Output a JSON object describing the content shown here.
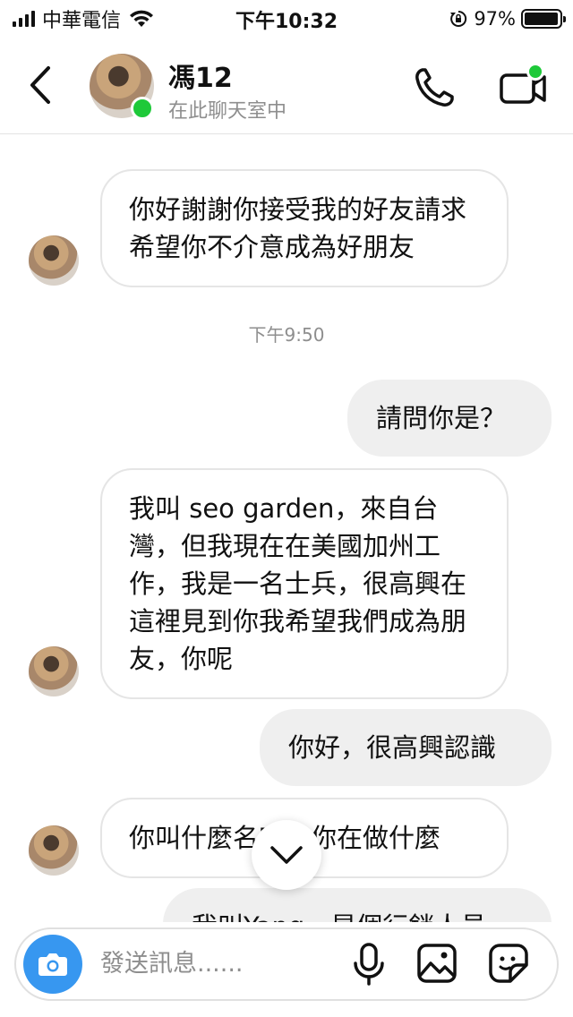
{
  "status_bar": {
    "carrier": "中華電信",
    "time": "下午10:32",
    "battery": "97%",
    "battery_level": 0.97
  },
  "header": {
    "contact_name": "馮12",
    "contact_status": "在此聊天室中"
  },
  "messages": [
    {
      "direction": "incoming",
      "text": "你好謝謝你接受我的好友請求希望你不介意成為好朋友"
    },
    {
      "type": "timestamp",
      "text": "下午9:50"
    },
    {
      "direction": "outgoing",
      "text": "請問你是？"
    },
    {
      "direction": "incoming",
      "text": "我叫 seo garden，來自台灣，但我現在在美國加州工作，我是一名士兵，很高興在這裡見到你我希望我們成為朋友，你呢"
    },
    {
      "direction": "outgoing",
      "text": "你好，很高興認識"
    },
    {
      "direction": "incoming",
      "text": "你叫什麼名字，你在做什麼"
    },
    {
      "direction": "outgoing",
      "text": "我叫Yang，是個行銷人員"
    }
  ],
  "composer": {
    "placeholder": "發送訊息......"
  },
  "icons": {
    "back": "chevron-left-icon",
    "call": "phone-icon",
    "video": "video-camera-icon",
    "scroll": "chevron-down-icon",
    "camera": "camera-icon",
    "mic": "microphone-icon",
    "gallery": "image-icon",
    "sticker": "sticker-icon"
  },
  "colors": {
    "online": "#1ec939",
    "accent": "#3797f0",
    "outgoing_bubble": "#efefef",
    "meta_text": "#8e8e8e"
  }
}
